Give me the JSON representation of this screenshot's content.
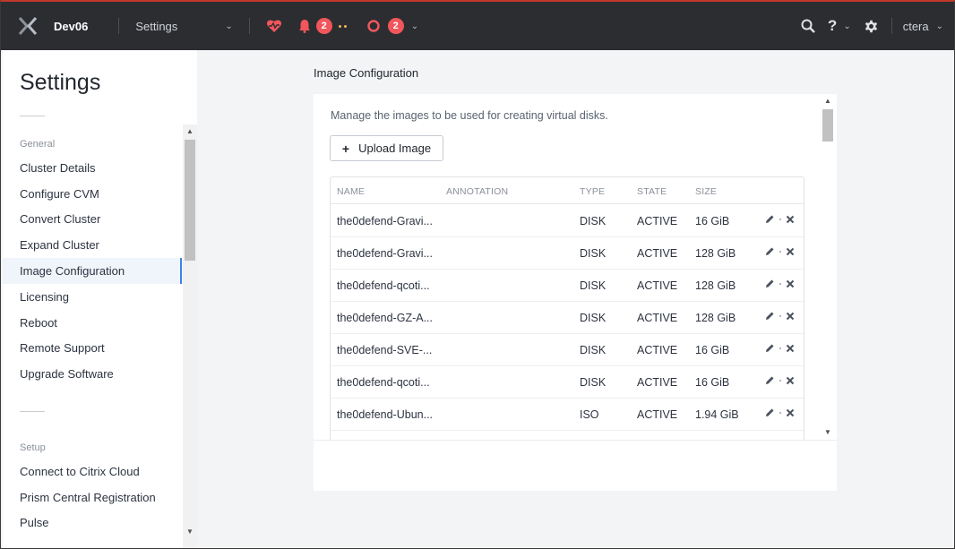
{
  "topbar": {
    "cluster_name": "Dev06",
    "nav_label": "Settings",
    "alert_count": "2",
    "task_count": "2",
    "user": "ctera"
  },
  "sidebar": {
    "title": "Settings",
    "sections": [
      {
        "label": "General",
        "items": [
          {
            "label": "Cluster Details"
          },
          {
            "label": "Configure CVM"
          },
          {
            "label": "Convert Cluster"
          },
          {
            "label": "Expand Cluster"
          },
          {
            "label": "Image Configuration",
            "active": true
          },
          {
            "label": "Licensing"
          },
          {
            "label": "Reboot"
          },
          {
            "label": "Remote Support"
          },
          {
            "label": "Upgrade Software"
          }
        ]
      },
      {
        "label": "Setup",
        "items": [
          {
            "label": "Connect to Citrix Cloud"
          },
          {
            "label": "Prism Central Registration"
          },
          {
            "label": "Pulse"
          }
        ]
      }
    ]
  },
  "main": {
    "page_title": "Image Configuration",
    "description": "Manage the images to be used for creating virtual disks.",
    "upload_label": "Upload Image",
    "columns": [
      "NAME",
      "ANNOTATION",
      "TYPE",
      "STATE",
      "SIZE"
    ],
    "rows": [
      {
        "name": "the0defend-Gravi...",
        "annotation": "",
        "type": "DISK",
        "state": "ACTIVE",
        "size": "16 GiB"
      },
      {
        "name": "the0defend-Gravi...",
        "annotation": "",
        "type": "DISK",
        "state": "ACTIVE",
        "size": "128 GiB"
      },
      {
        "name": "the0defend-qcoti...",
        "annotation": "",
        "type": "DISK",
        "state": "ACTIVE",
        "size": "128 GiB"
      },
      {
        "name": "the0defend-GZ-A...",
        "annotation": "",
        "type": "DISK",
        "state": "ACTIVE",
        "size": "128 GiB"
      },
      {
        "name": "the0defend-SVE-...",
        "annotation": "",
        "type": "DISK",
        "state": "ACTIVE",
        "size": "16 GiB"
      },
      {
        "name": "the0defend-qcoti...",
        "annotation": "",
        "type": "DISK",
        "state": "ACTIVE",
        "size": "16 GiB"
      },
      {
        "name": "the0defend-Ubun...",
        "annotation": "",
        "type": "ISO",
        "state": "ACTIVE",
        "size": "1.94 GiB"
      }
    ]
  },
  "colors": {
    "topbar_bg": "#2b2d31",
    "badge_red": "#f0565b",
    "active_accent": "#3b83ec",
    "health_icon": "#f0565b"
  }
}
